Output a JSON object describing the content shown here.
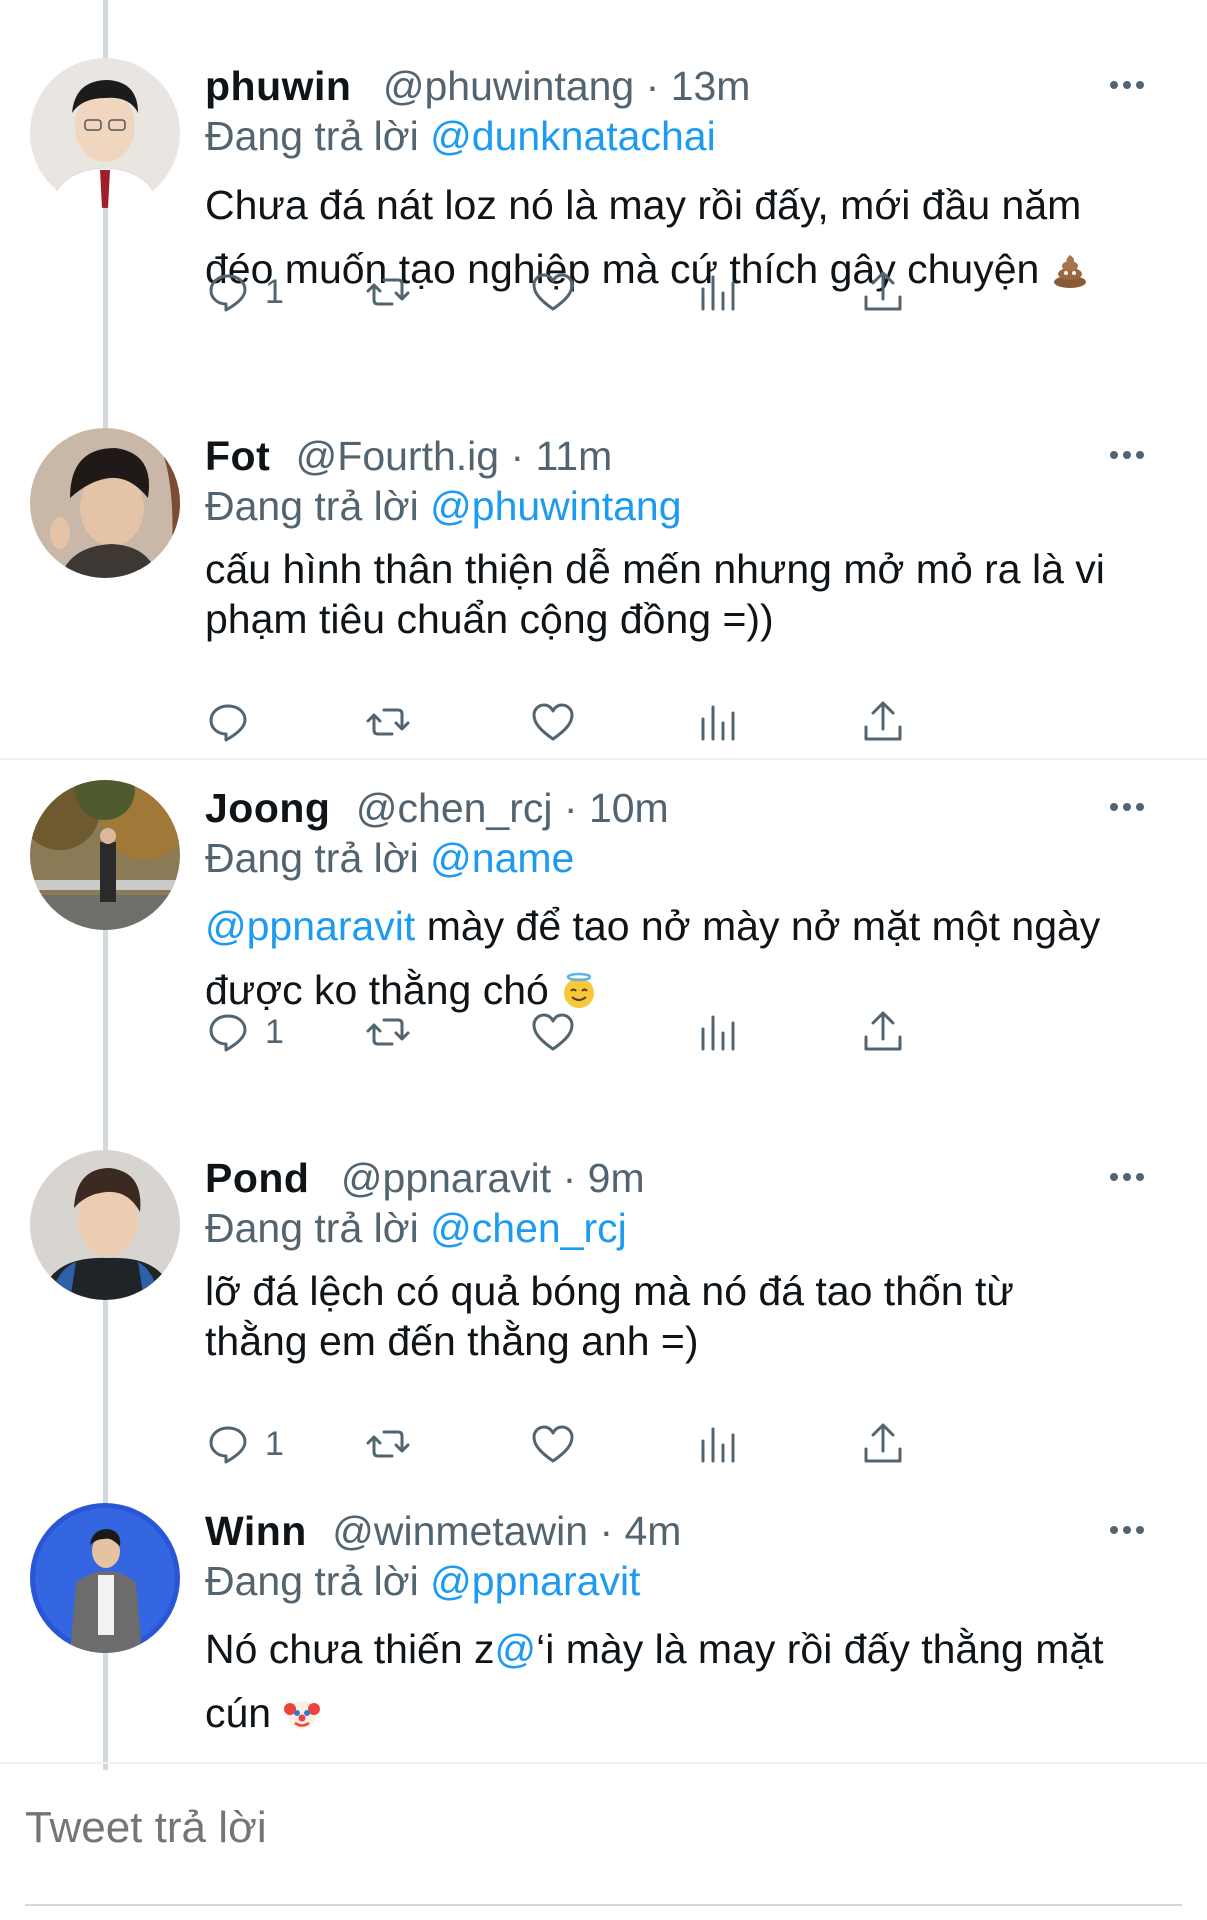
{
  "replying_label": "Đang trả lời",
  "tweets": [
    {
      "name": "phuwin",
      "handle": "@phuwintang",
      "time": "13m",
      "reply_to": "@dunknatachai",
      "line1": "Chưa đá nát loz nó là may rồi đấy, mới đầu năm",
      "line2": "đéo muốn tạo nghiệp mà cứ thích gây chuyện",
      "emoji": "poop",
      "reply_count": "1"
    },
    {
      "name": "Fot",
      "handle": "@Fourth.ig",
      "time": "11m",
      "reply_to": "@phuwintang",
      "line1": "cấu hình thân thiện dễ mến nhưng mở mỏ ra là vi",
      "line2": "phạm tiêu chuẩn cộng đồng =))",
      "reply_count": ""
    },
    {
      "name": "Joong",
      "handle": "@chen_rcj",
      "time": "10m",
      "reply_to": "@name",
      "line1_mention": "@ppnaravit",
      "line1": " mày để tao nở mày nở mặt một ngày",
      "line2": "được ko thằng chó",
      "emoji": "halo",
      "reply_count": "1"
    },
    {
      "name": "Pond",
      "handle": "@ppnaravit",
      "time": "9m",
      "reply_to": "@chen_rcj",
      "line1": "lỡ đá lệch có quả bóng mà nó đá tao thốn từ",
      "line2": "thằng em đến thằng anh =)",
      "reply_count": "1"
    },
    {
      "name": "Winn",
      "handle": "@winmetawin",
      "time": "4m",
      "reply_to": "@ppnaravit",
      "line1_a": "Nó chưa thiến z",
      "line1_at": "@",
      "line1_b": "‘i mày là may rồi đấy thằng mặt",
      "line2": "cún",
      "emoji": "clown"
    }
  ],
  "reply_box": {
    "placeholder": "Tweet trả lời"
  },
  "colors": {
    "accent": "#1d9bf0",
    "secondary": "#536471",
    "divider": "#eff3f4"
  },
  "icons": [
    "reply-icon",
    "retweet-icon",
    "like-icon",
    "analytics-icon",
    "share-icon",
    "more-icon"
  ]
}
